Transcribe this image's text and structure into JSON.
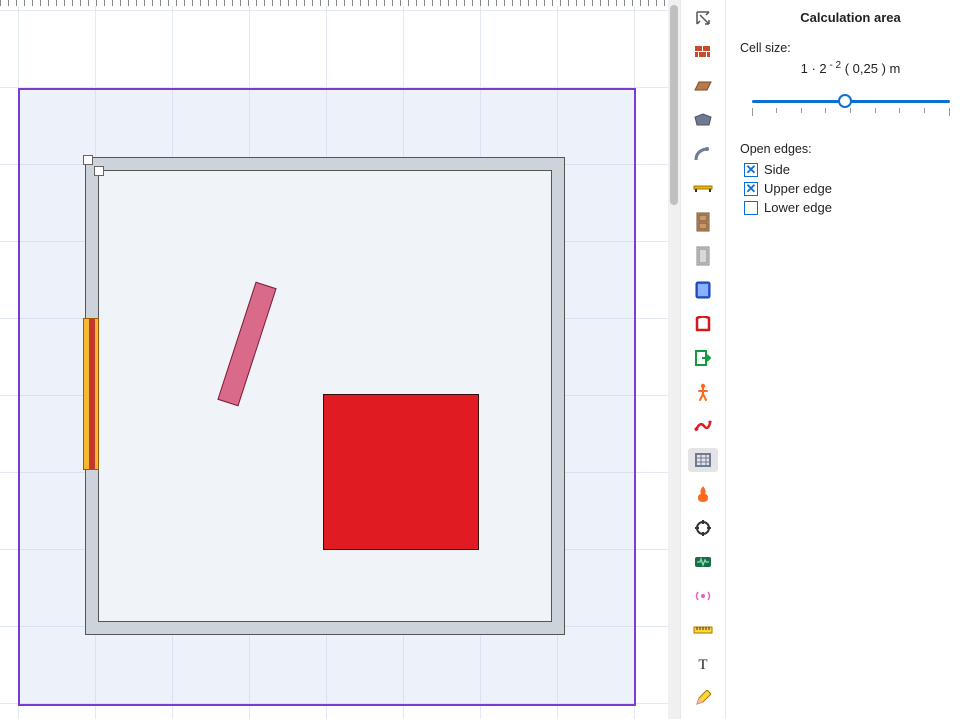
{
  "panel": {
    "title": "Calculation area",
    "cell_size_label": "Cell size:",
    "formula_prefix": "1 · 2",
    "formula_exp": " - 2",
    "formula_result": "( 0,25 )  m",
    "open_edges_label": "Open edges:",
    "checks": {
      "side": {
        "label": "Side",
        "checked": true
      },
      "upper": {
        "label": "Upper edge",
        "checked": true
      },
      "lower": {
        "label": "Lower edge",
        "checked": false
      }
    },
    "slider_value": 0.48
  },
  "toolbar": [
    {
      "name": "select-icon",
      "color": "#555"
    },
    {
      "name": "brick-icon",
      "color": "#c94a2c"
    },
    {
      "name": "slab-icon",
      "color": "#b87a4a"
    },
    {
      "name": "polygon-icon",
      "color": "#6f7a93"
    },
    {
      "name": "stair-icon",
      "color": "#6f7a93"
    },
    {
      "name": "beam-icon",
      "color": "#e6b800"
    },
    {
      "name": "door-wood-icon",
      "color": "#9c6b3f"
    },
    {
      "name": "door-grey-icon",
      "color": "#9c9c9c"
    },
    {
      "name": "window-icon",
      "color": "#1f4fd1"
    },
    {
      "name": "opening-icon",
      "color": "#d11b1b"
    },
    {
      "name": "exit-icon",
      "color": "#0f9d3b"
    },
    {
      "name": "person-icon",
      "color": "#ff6a1f"
    },
    {
      "name": "path-icon",
      "color": "#e11b22"
    },
    {
      "name": "calc-area-icon",
      "color": "#6f7a93",
      "active": true
    },
    {
      "name": "fire-icon",
      "color": "#ff6a1f"
    },
    {
      "name": "target-icon",
      "color": "#333"
    },
    {
      "name": "sensor-icon",
      "color": "#1a6e46"
    },
    {
      "name": "radial-icon",
      "color": "#e561c3"
    },
    {
      "name": "ruler-icon",
      "color": "#e6b800"
    },
    {
      "name": "text-icon",
      "color": "#222"
    },
    {
      "name": "pencil-icon",
      "color": "#e6b800"
    }
  ],
  "canvas": {
    "border_color": "#7a3bd1",
    "fill_color": "rgba(200,215,240,0.35)",
    "objects": [
      "room-wall",
      "door",
      "plank",
      "red-square"
    ]
  }
}
